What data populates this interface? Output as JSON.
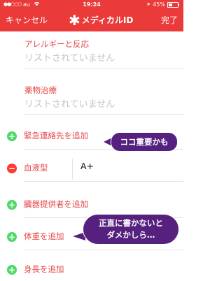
{
  "status_bar": {
    "signal": "●●○○○",
    "carrier": "au",
    "wifi_icon": "wifi-icon",
    "time": "19:24",
    "battery_text": "45%",
    "battery_level": 0.45
  },
  "nav": {
    "cancel_label": "キャンセル",
    "title_icon": "✱",
    "title": "メディカルID",
    "done_label": "完了"
  },
  "sections": {
    "allergies": {
      "label": "アレルギーと反応",
      "value": "リストされていません"
    },
    "medications": {
      "label": "薬物治療",
      "value": "リストされていません"
    }
  },
  "rows": {
    "emergency_contact": {
      "label": "緊急連絡先を追加",
      "icon": "plus"
    },
    "blood_type": {
      "label": "血液型",
      "value": "A+",
      "icon": "minus"
    },
    "organ_donor": {
      "label": "臓器提供者を追加",
      "icon": "plus"
    },
    "weight": {
      "label": "体重を追加",
      "icon": "plus"
    },
    "height": {
      "label": "身長を追加",
      "icon": "plus"
    }
  },
  "annotations": {
    "bubble1": "ココ重要かも",
    "bubble2_line1": "正直に書かないと",
    "bubble2_line2": "ダメかしら…"
  },
  "colors": {
    "nav_red": "#ea3a3a",
    "label_red": "#e64545",
    "add_green": "#4cd964",
    "remove_red": "#ff3b30",
    "bubble_purple": "#56207f"
  }
}
